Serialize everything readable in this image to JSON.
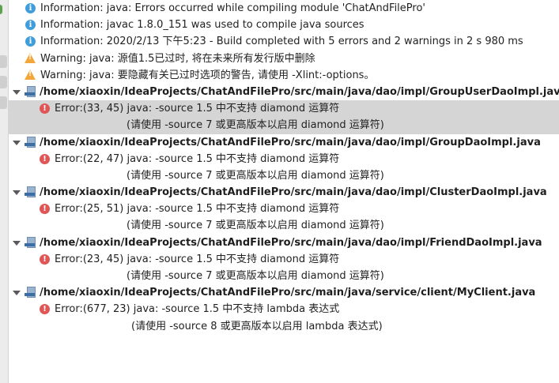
{
  "messages": [
    {
      "type": "info",
      "text": "Information: java: Errors occurred while compiling module 'ChatAndFilePro'"
    },
    {
      "type": "info",
      "text": "Information: javac 1.8.0_151 was used to compile java sources"
    },
    {
      "type": "info",
      "text": "Information: 2020/2/13 下午5:23 - Build completed with 5 errors and 2 warnings in 2 s 980 ms"
    },
    {
      "type": "warning",
      "text": "Warning: java: 源值1.5已过时, 将在未来所有发行版中删除"
    },
    {
      "type": "warning",
      "text": "Warning: java: 要隐藏有关已过时选项的警告, 请使用 -Xlint:-options。"
    }
  ],
  "files": [
    {
      "path": "/home/xiaoxin/IdeaProjects/ChatAndFilePro/src/main/java/dao/impl/GroupUserDaoImpl.java",
      "error": "Error:(33, 45)  java: -source 1.5 中不支持 diamond 运算符",
      "hint": "(请使用 -source 7 或更高版本以启用 diamond 运算符)"
    },
    {
      "path": "/home/xiaoxin/IdeaProjects/ChatAndFilePro/src/main/java/dao/impl/GroupDaoImpl.java",
      "error": "Error:(22, 47)  java: -source 1.5 中不支持 diamond 运算符",
      "hint": "(请使用 -source 7 或更高版本以启用 diamond 运算符)"
    },
    {
      "path": "/home/xiaoxin/IdeaProjects/ChatAndFilePro/src/main/java/dao/impl/ClusterDaoImpl.java",
      "error": "Error:(25, 51)  java: -source 1.5 中不支持 diamond 运算符",
      "hint": "(请使用 -source 7 或更高版本以启用 diamond 运算符)"
    },
    {
      "path": "/home/xiaoxin/IdeaProjects/ChatAndFilePro/src/main/java/dao/impl/FriendDaoImpl.java",
      "error": "Error:(23, 45)  java: -source 1.5 中不支持 diamond 运算符",
      "hint": "(请使用 -source 7 或更高版本以启用 diamond 运算符)"
    },
    {
      "path": "/home/xiaoxin/IdeaProjects/ChatAndFilePro/src/main/java/service/client/MyClient.java",
      "error": "Error:(677, 23)  java: -source 1.5 中不支持 lambda 表达式",
      "hint": "(请使用 -source 8 或更高版本以启用 lambda 表达式)"
    }
  ]
}
